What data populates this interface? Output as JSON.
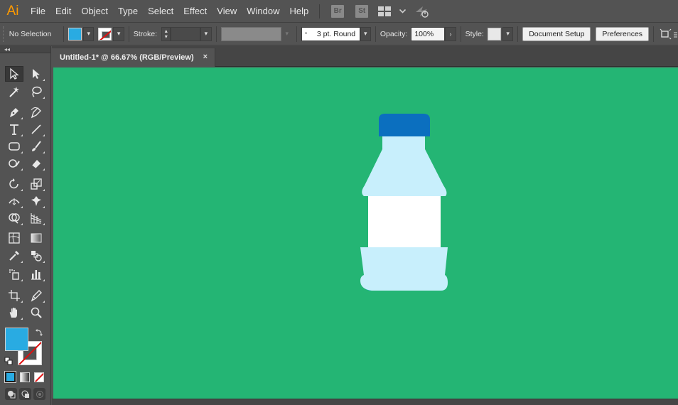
{
  "app": {
    "logo": "Ai",
    "accent": "#ff9a00"
  },
  "menu": {
    "items": [
      "File",
      "Edit",
      "Object",
      "Type",
      "Select",
      "Effect",
      "View",
      "Window",
      "Help"
    ],
    "badges": [
      "Br",
      "St"
    ],
    "icons": [
      "workspace-layout-icon",
      "chevron-down-icon",
      "gpu-performance-icon"
    ]
  },
  "control": {
    "selection_label": "No Selection",
    "fill_color": "#29abe2",
    "stroke_label": "Stroke:",
    "brush_value": "3 pt. Round",
    "opacity_label": "Opacity:",
    "opacity_value": "100%",
    "style_label": "Style:",
    "document_setup": "Document Setup",
    "preferences": "Preferences"
  },
  "document": {
    "tab_title": "Untitled-1* @ 66.67% (RGB/Preview)",
    "close_symbol": "×",
    "canvas_color": "#24b574"
  },
  "artwork": {
    "cap_color": "#0b6fbf",
    "bottle_color": "#c8effc",
    "label_color": "#ffffff",
    "shadow_color": "#29abe2"
  },
  "toolbox": {
    "fill_color": "#29abe2",
    "collapse_symbol": "◂◂",
    "tools": [
      "selection-tool-icon",
      "direct-selection-tool-icon",
      "magic-wand-tool-icon",
      "lasso-tool-icon",
      "pen-tool-icon",
      "curvature-tool-icon",
      "type-tool-icon",
      "line-segment-tool-icon",
      "rectangle-tool-icon",
      "paintbrush-tool-icon",
      "shaper-tool-icon",
      "eraser-tool-icon",
      "rotate-tool-icon",
      "scale-tool-icon",
      "width-tool-icon",
      "puppet-warp-tool-icon",
      "shape-builder-tool-icon",
      "perspective-grid-tool-icon",
      "mesh-tool-icon",
      "gradient-tool-icon",
      "eyedropper-tool-icon",
      "blend-tool-icon",
      "symbol-sprayer-tool-icon",
      "column-graph-tool-icon",
      "artboard-tool-icon",
      "slice-tool-icon",
      "hand-tool-icon",
      "zoom-tool-icon"
    ]
  }
}
